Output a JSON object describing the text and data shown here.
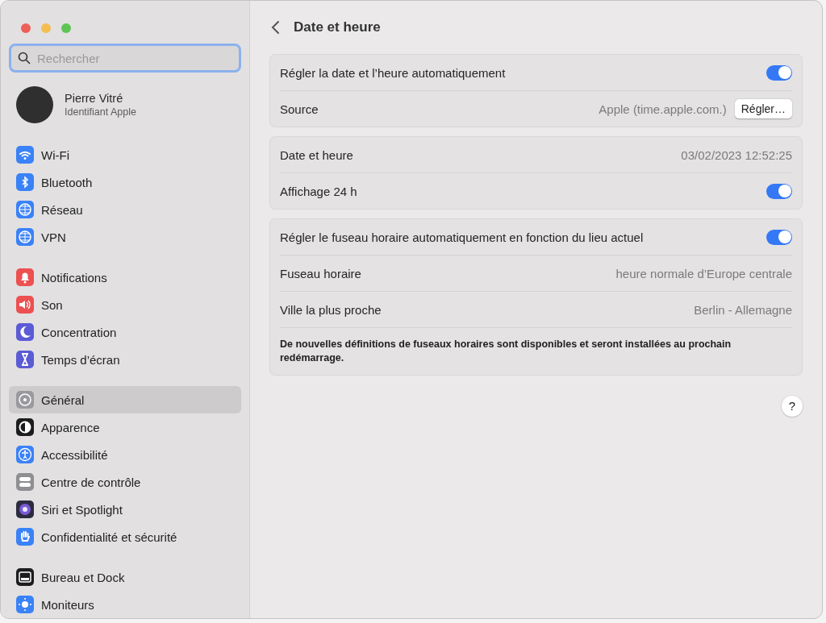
{
  "sidebar": {
    "search": {
      "placeholder": "Rechercher"
    },
    "profile": {
      "name": "Pierre Vitré",
      "subtitle": "Identifiant Apple"
    },
    "groups": [
      {
        "items": [
          {
            "label": "Wi-Fi",
            "selected": false
          },
          {
            "label": "Bluetooth",
            "selected": false
          },
          {
            "label": "Réseau",
            "selected": false
          },
          {
            "label": "VPN",
            "selected": false
          }
        ]
      },
      {
        "items": [
          {
            "label": "Notifications",
            "selected": false
          },
          {
            "label": "Son",
            "selected": false
          },
          {
            "label": "Concentration",
            "selected": false
          },
          {
            "label": "Temps d’écran",
            "selected": false
          }
        ]
      },
      {
        "items": [
          {
            "label": "Général",
            "selected": true
          },
          {
            "label": "Apparence",
            "selected": false
          },
          {
            "label": "Accessibilité",
            "selected": false
          },
          {
            "label": "Centre de contrôle",
            "selected": false
          },
          {
            "label": "Siri et Spotlight",
            "selected": false
          },
          {
            "label": "Confidentialité et sécurité",
            "selected": false
          }
        ]
      },
      {
        "items": [
          {
            "label": "Bureau et Dock",
            "selected": false
          },
          {
            "label": "Moniteurs",
            "selected": false
          }
        ]
      }
    ]
  },
  "content": {
    "title": "Date et heure",
    "groups": [
      {
        "rows": [
          {
            "kind": "toggle",
            "label": "Régler la date et l’heure automatiquement",
            "on": true
          },
          {
            "kind": "value-button",
            "label": "Source",
            "value": "Apple (time.apple.com.)",
            "button": "Régler…"
          }
        ]
      },
      {
        "rows": [
          {
            "kind": "value",
            "label": "Date et heure",
            "value": "03/02/2023 12:52:25"
          },
          {
            "kind": "toggle",
            "label": "Affichage 24 h",
            "on": true
          }
        ]
      },
      {
        "rows": [
          {
            "kind": "toggle",
            "label": "Régler le fuseau horaire automatiquement en fonction du lieu actuel",
            "on": true
          },
          {
            "kind": "value",
            "label": "Fuseau horaire",
            "value": "heure normale d’Europe centrale"
          },
          {
            "kind": "value",
            "label": "Ville la plus proche",
            "value": "Berlin - Allemagne"
          },
          {
            "kind": "note",
            "label": "De nouvelles définitions de fuseaux horaires sont disponibles et seront installées au prochain redémarrage."
          }
        ]
      }
    ],
    "help": "?"
  }
}
